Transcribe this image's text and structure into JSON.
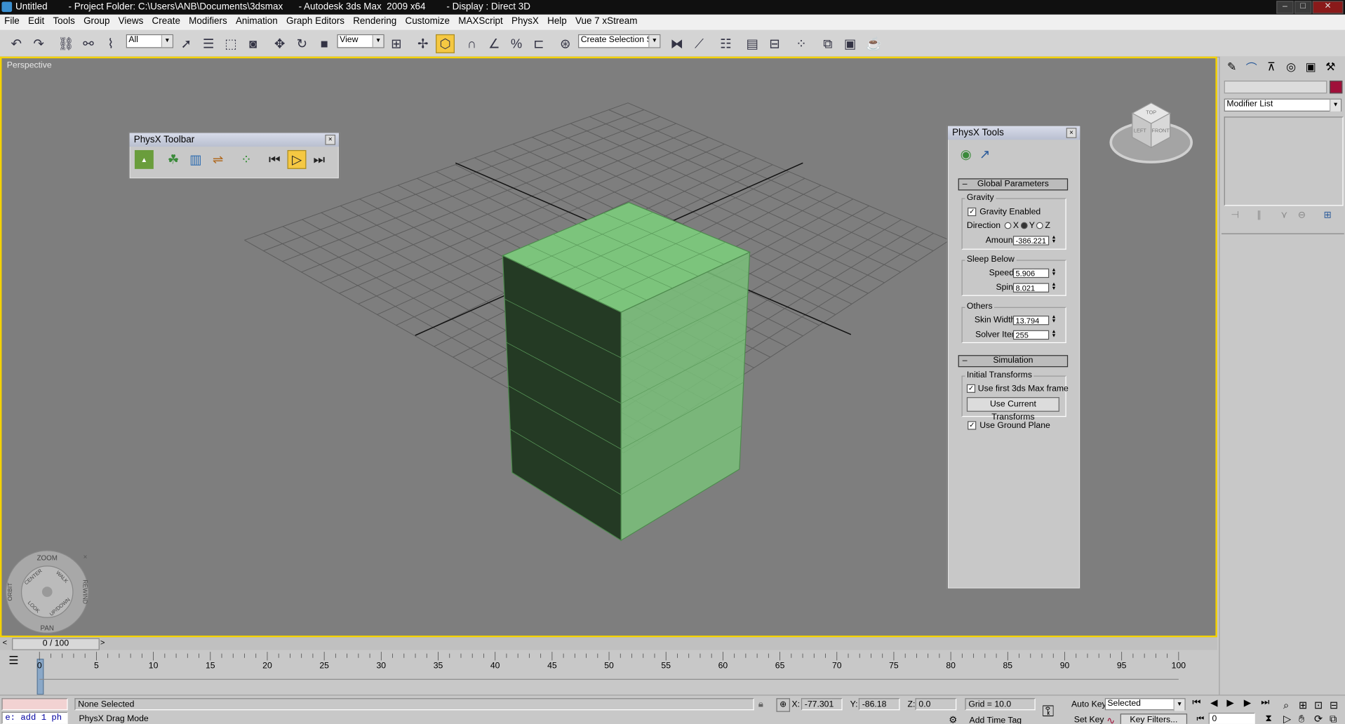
{
  "title": {
    "text": "Untitled        - Project Folder: C:\\Users\\ANB\\Documents\\3dsmax      - Autodesk 3ds Max  2009 x64        - Display : Direct 3D"
  },
  "menu": [
    "File",
    "Edit",
    "Tools",
    "Group",
    "Views",
    "Create",
    "Modifiers",
    "Animation",
    "Graph Editors",
    "Rendering",
    "Customize",
    "MAXScript",
    "PhysX",
    "Help",
    "Vue 7 xStream"
  ],
  "toolbar": {
    "selection_filter": "All",
    "reference_coord": "View",
    "named_selection": "Create Selection Set"
  },
  "viewport": {
    "label": "Perspective",
    "border_color": "#f5d300",
    "object_color": "#7cc47c"
  },
  "viewcube": {
    "top": "TOP",
    "left": "LEFT",
    "front": "FRONT"
  },
  "steering_wheel": {
    "zoom": "ZOOM",
    "orbit": "ORBIT",
    "rewind": "REWIND",
    "pan": "PAN",
    "center": "CENTER",
    "walk": "WALK",
    "look": "LOOK",
    "updown": "UP/DOWN"
  },
  "physx_toolbar": {
    "title": "PhysX Toolbar",
    "buttons": [
      "physx-logo-icon",
      "rigid-body-icon",
      "cloth-icon",
      "constraint-icon",
      "explode-icon",
      "rewind-icon",
      "play-icon",
      "step-icon"
    ]
  },
  "physx_tools": {
    "title": "PhysX Tools",
    "global": {
      "rollout": "Global Parameters",
      "gravity_group": "Gravity",
      "gravity_enabled": "Gravity Enabled",
      "direction_label": "Direction",
      "dir_x": "X",
      "dir_y": "Y",
      "dir_z": "Z",
      "amount_label": "Amount",
      "amount_value": "-386.221",
      "sleep_group": "Sleep Below",
      "speed_label": "Speed",
      "speed_value": "5.906",
      "spin_label": "Spin",
      "spin_value": "8.021",
      "others_group": "Others",
      "skin_label": "Skin Width",
      "skin_value": "13.794",
      "solver_label": "Solver Iter.",
      "solver_value": "255"
    },
    "simulation": {
      "rollout": "Simulation",
      "initial_group": "Initial Transforms",
      "use_first": "Use first 3ds Max frame",
      "use_current": "Use Current Transforms",
      "ground_plane": "Use Ground Plane"
    }
  },
  "command_panel": {
    "modifier_list": "Modifier List",
    "object_color": "#a0103a"
  },
  "timeline": {
    "frame_display": "0 / 100",
    "ticks": [
      "0",
      "5",
      "10",
      "15",
      "20",
      "25",
      "30",
      "35",
      "40",
      "45",
      "50",
      "55",
      "60",
      "65",
      "70",
      "75",
      "80",
      "85",
      "90",
      "95",
      "100"
    ]
  },
  "status": {
    "selection": "None Selected",
    "prompt": "PhysX Drag Mode",
    "maxscript": "e: add 1 ph",
    "x_label": "X:",
    "x_value": "-77.301",
    "y_label": "Y:",
    "y_value": "-86.18",
    "z_label": "Z:",
    "z_value": "0.0",
    "grid": "Grid = 10.0",
    "add_time_tag": "Add Time Tag",
    "auto_key": "Auto Key",
    "set_key": "Set Key",
    "key_mode": "Selected",
    "key_filters": "Key Filters...",
    "frame": "0"
  }
}
